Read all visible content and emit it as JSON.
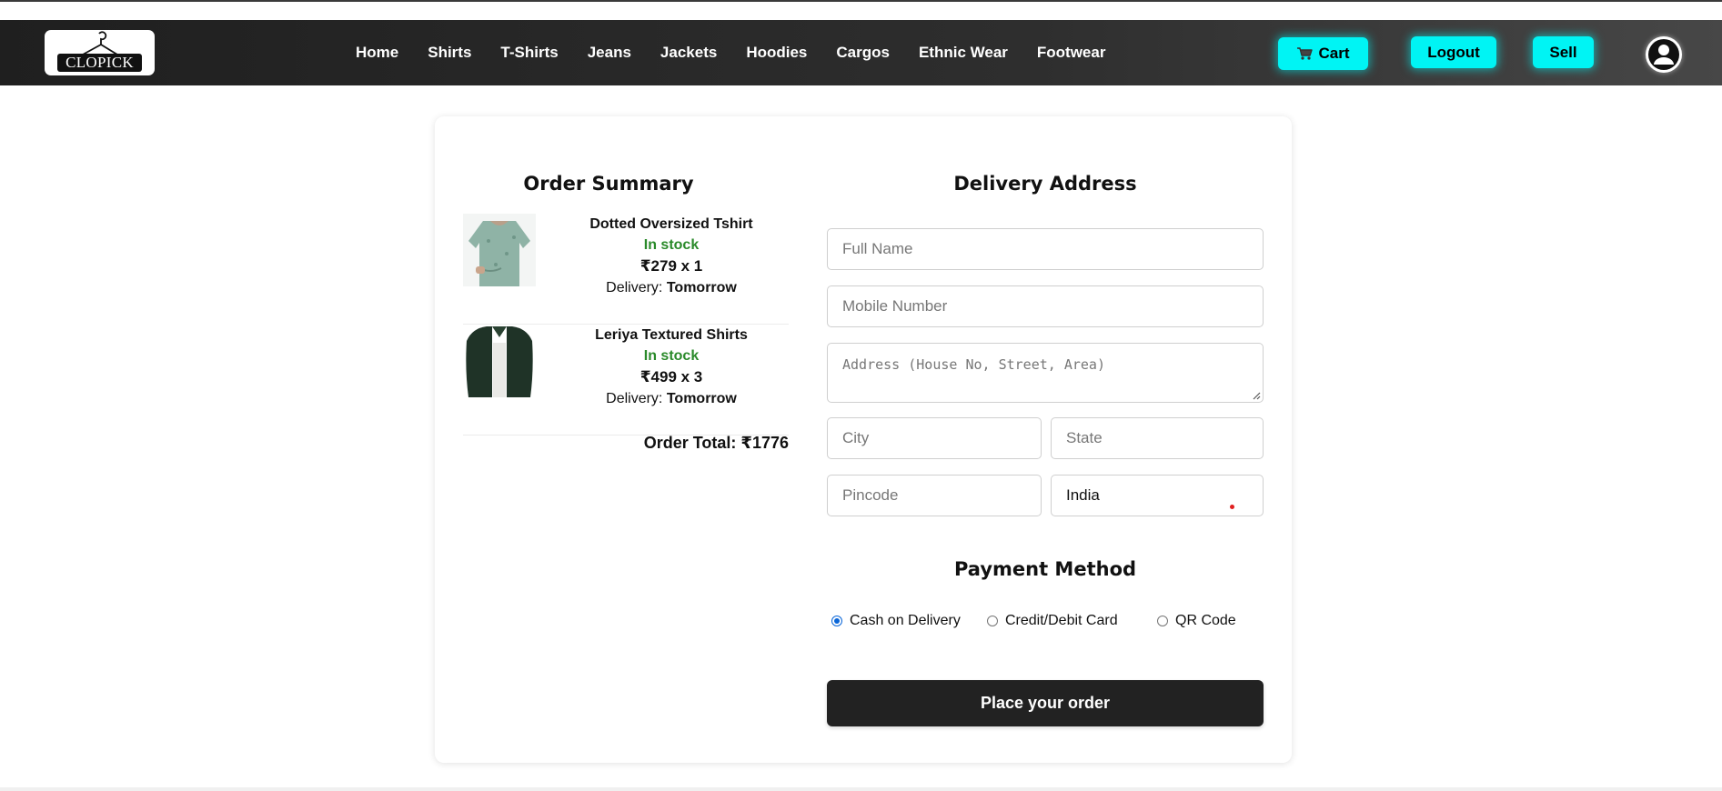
{
  "brand": {
    "logo_text": "CLOPICK"
  },
  "nav": {
    "links": [
      "Home",
      "Shirts",
      "T-Shirts",
      "Jeans",
      "Jackets",
      "Hoodies",
      "Cargos",
      "Ethnic Wear",
      "Footwear"
    ],
    "cart_label": "Cart",
    "logout_label": "Logout",
    "sell_label": "Sell"
  },
  "order_summary": {
    "title": "Order Summary",
    "items": [
      {
        "name": "Dotted Oversized Tshirt",
        "stock": "In stock",
        "price_qty": "₹279 x 1",
        "delivery_label": "Delivery:",
        "delivery_value": "Tomorrow"
      },
      {
        "name": "Leriya Textured Shirts",
        "stock": "In stock",
        "price_qty": "₹499 x 3",
        "delivery_label": "Delivery:",
        "delivery_value": "Tomorrow"
      }
    ],
    "total": "Order Total: ₹1776"
  },
  "delivery": {
    "title": "Delivery Address",
    "full_name_placeholder": "Full Name",
    "mobile_placeholder": "Mobile Number",
    "address_placeholder": "Address (House No, Street, Area)",
    "city_placeholder": "City",
    "state_placeholder": "State",
    "pincode_placeholder": "Pincode",
    "country_value": "India"
  },
  "payment": {
    "title": "Payment Method",
    "options": [
      "Cash on Delivery",
      "Credit/Debit Card",
      "QR Code"
    ],
    "selected": "Cash on Delivery"
  },
  "place_order_label": "Place your order",
  "colors": {
    "accent": "#00f4f4",
    "navbar": "#2a2a2a",
    "stock_green": "#2a8a2a",
    "primary_button": "#222222"
  }
}
